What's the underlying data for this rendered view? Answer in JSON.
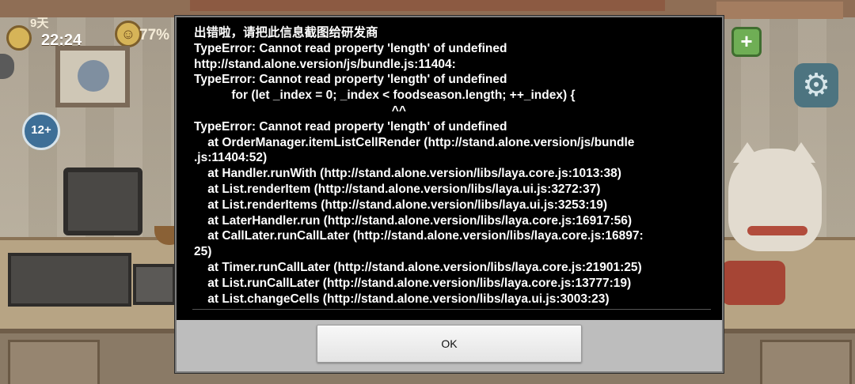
{
  "hud": {
    "day": "9天",
    "time": "22:24",
    "satisfaction": "77%",
    "age_rating": "12+"
  },
  "dialog": {
    "message_lines": [
      "出错啦，请把此信息截图给研发商",
      "TypeError: Cannot read property 'length' of undefined",
      "http://stand.alone.version/js/bundle.js:11404:",
      "TypeError: Cannot read property 'length' of undefined",
      "           for (let _index = 0; _index < foodseason.length; ++_index) {",
      "                                                          ^^",
      "TypeError: Cannot read property 'length' of undefined",
      "    at OrderManager.itemListCellRender (http://stand.alone.version/js/bundle",
      ".js:11404:52)",
      "    at Handler.runWith (http://stand.alone.version/libs/laya.core.js:1013:38)",
      "    at List.renderItem (http://stand.alone.version/libs/laya.ui.js:3272:37)",
      "    at List.renderItems (http://stand.alone.version/libs/laya.ui.js:3253:19)",
      "    at LaterHandler.run (http://stand.alone.version/libs/laya.core.js:16917:56)",
      "    at CallLater.runCallLater (http://stand.alone.version/libs/laya.core.js:16897:",
      "25)",
      "    at Timer.runCallLater (http://stand.alone.version/libs/laya.core.js:21901:25)",
      "    at List.runCallLater (http://stand.alone.version/libs/laya.core.js:13777:19)",
      "    at List.changeCells (http://stand.alone.version/libs/laya.ui.js:3003:23)"
    ],
    "ok_label": "OK"
  },
  "icons": {
    "moon": "moon-icon",
    "smile": "smile-icon",
    "plus": "plus-icon",
    "gear": "gear-icon"
  },
  "colors": {
    "dialog_bg": "#000000",
    "dialog_text": "#ffffff",
    "button_bar": "#bdbdbd"
  }
}
